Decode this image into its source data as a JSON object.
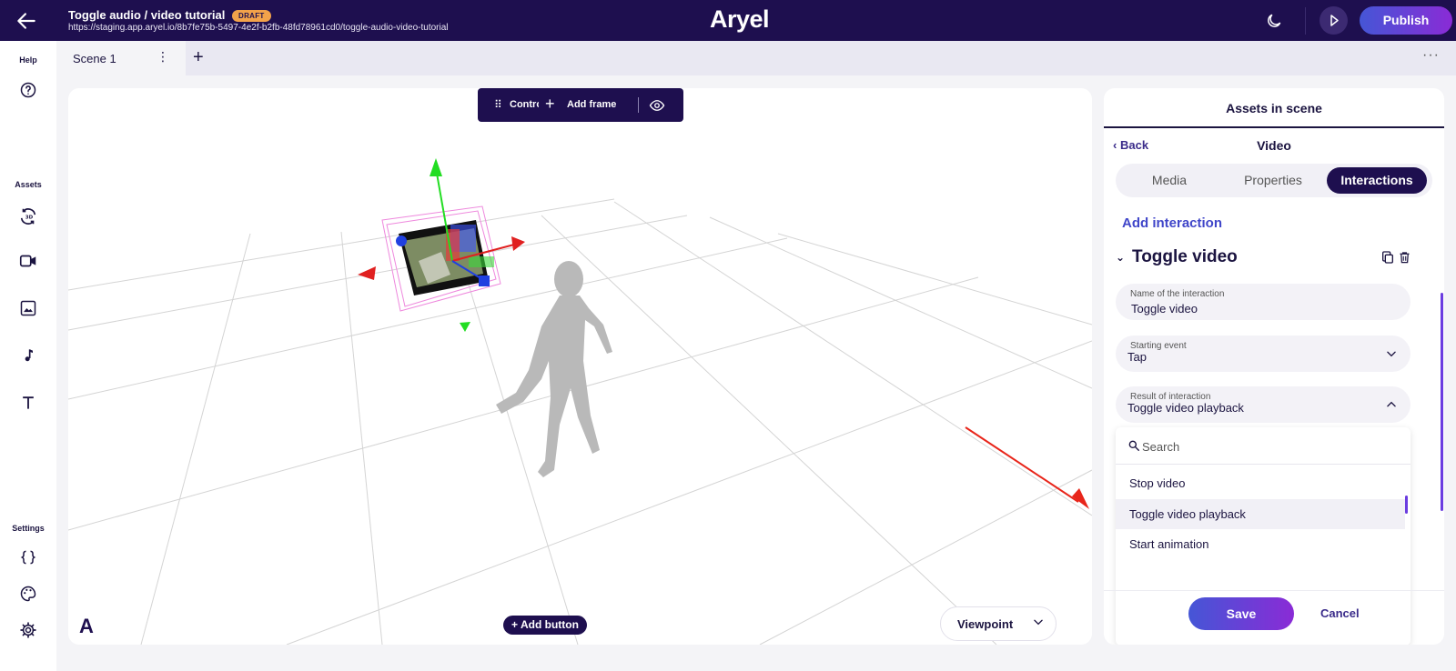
{
  "topbar": {
    "title": "Toggle audio / video tutorial",
    "badge": "DRAFT",
    "url": "https://staging.app.aryel.io/8b7fe75b-5497-4e2f-b2fb-48fd78961cd0/toggle-audio-video-tutorial",
    "logo": "Aryel",
    "publish": "Publish",
    "icons": [
      "back-arrow-icon",
      "moon-icon",
      "play-icon"
    ]
  },
  "sidebar": {
    "help_label": "Help",
    "assets_label": "Assets",
    "settings_label": "Settings",
    "icons": [
      "help-icon",
      "3d-rotate-icon",
      "video-icon",
      "image-icon",
      "music-note-icon",
      "text-icon",
      "code-braces-icon",
      "palette-icon",
      "gear-icon"
    ]
  },
  "tabs": {
    "scene": "Scene 1",
    "add": "+",
    "more": "···"
  },
  "canvas": {
    "toolbar_control": "Contro",
    "toolbar_add_frame": "Add frame",
    "add_button": "Add button",
    "viewpoint": "Viewpoint",
    "logo_mark": "A"
  },
  "panel": {
    "header": "Assets in scene",
    "back": "Back",
    "subtitle": "Video",
    "segments": [
      "Media",
      "Properties",
      "Interactions"
    ],
    "active_segment": "Interactions",
    "add_interaction": "Add interaction",
    "group_title": "Toggle video",
    "name_label": "Name of the interaction",
    "name_value": "Toggle video",
    "event_label": "Starting event",
    "event_value": "Tap",
    "result_label": "Result of interaction",
    "result_value": "Toggle video playback",
    "search_placeholder": "Search",
    "options": [
      "Stop video",
      "Toggle video playback",
      "Start animation"
    ],
    "selected_option": "Toggle video playback",
    "save": "Save",
    "cancel": "Cancel"
  },
  "colors": {
    "brand_dark": "#1e0f4f",
    "accent": "#4556d6",
    "accent_end": "#8a2bd6",
    "badge": "#f2a24a",
    "arrow": "#e8251a"
  }
}
